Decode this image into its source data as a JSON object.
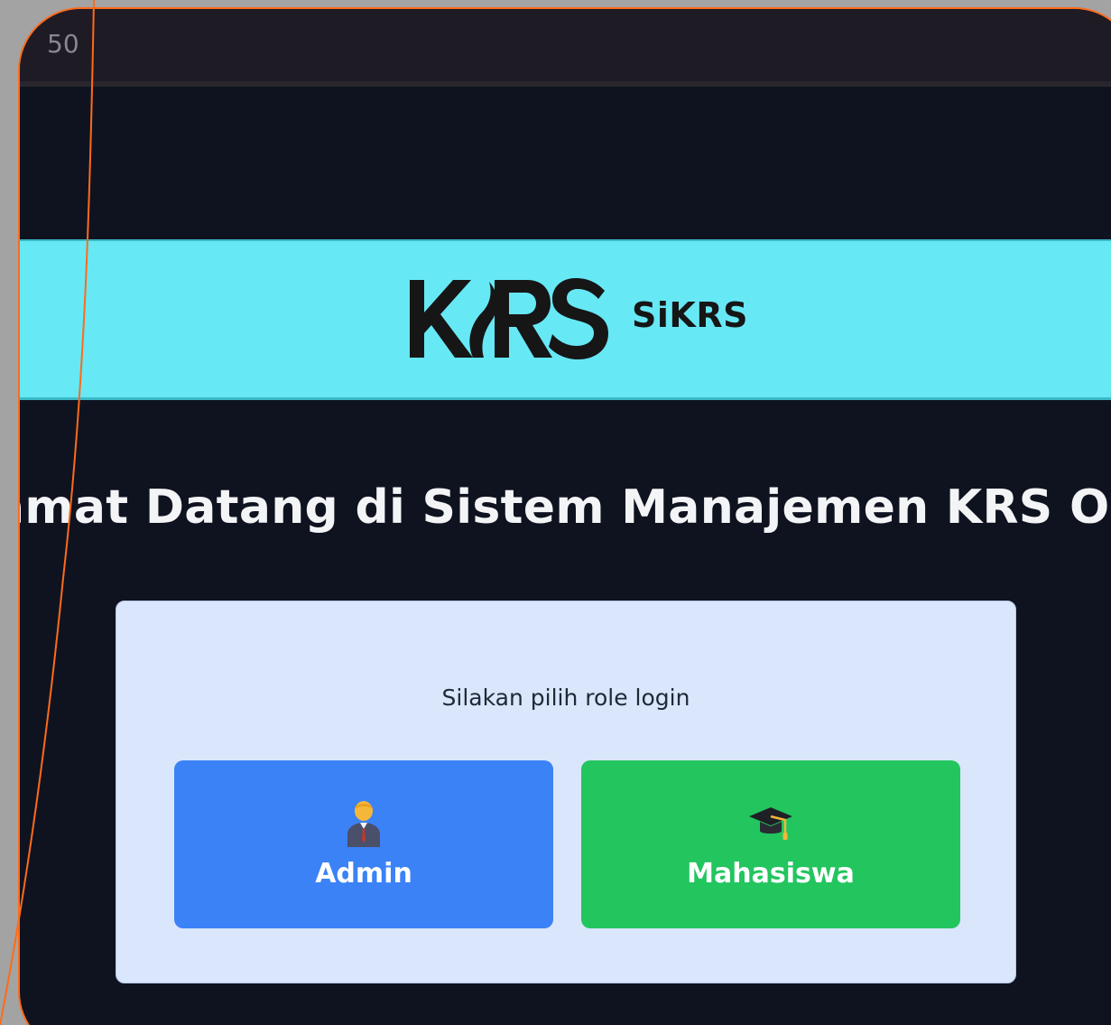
{
  "window": {
    "titlebar_text": "50"
  },
  "brand": {
    "logo_text": "KRS",
    "app_name": "SiKRS",
    "band_color": "#67e8f5"
  },
  "main": {
    "welcome_text": "amat Datang di Sistem Manajemen KRS Onl"
  },
  "login": {
    "prompt": "Silakan pilih role login",
    "roles": [
      {
        "label": "Admin",
        "icon": "admin-person-icon",
        "color": "#3b82f6"
      },
      {
        "label": "Mahasiswa",
        "icon": "graduation-cap-icon",
        "color": "#22c55e"
      }
    ]
  }
}
